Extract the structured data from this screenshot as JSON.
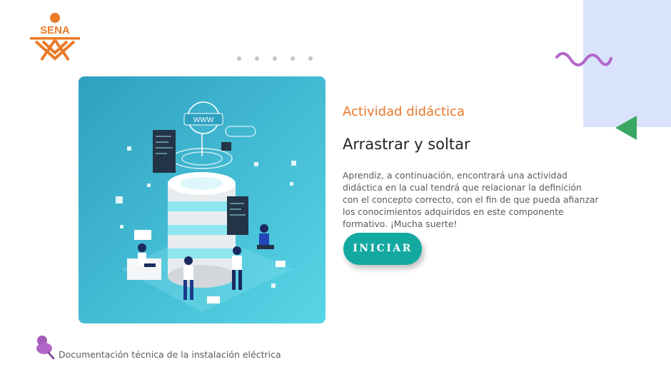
{
  "brand": {
    "logo_text": "SENA",
    "logo_color": "#ea7a27"
  },
  "slider": {
    "dots": 5
  },
  "activity": {
    "kicker": "Actividad didáctica",
    "title": "Arrastrar y soltar",
    "description": "Aprendiz, a continuación, encontrará una actividad didáctica en la cual tendrá que relacionar la definición con el concepto correcto, con el fin de que pueda afianzar los conocimientos adquiridos en este componente formativo. ¡Mucha suerte!",
    "start_label": "INICIAR"
  },
  "footer": {
    "text": "Documentación técnica de la instalación eléctrica"
  },
  "colors": {
    "accent_orange": "#e8782a",
    "button_teal": "#13a9a1",
    "deco_blue": "#d9e3fb",
    "deco_purple": "#b266c8",
    "deco_green": "#3aa864"
  },
  "icons": {
    "logo": "sena-logo",
    "illustration": "database-server-illustration",
    "decor_wave": "squiggle-icon",
    "decor_triangle": "triangle-icon",
    "footer": "pin-icon"
  }
}
